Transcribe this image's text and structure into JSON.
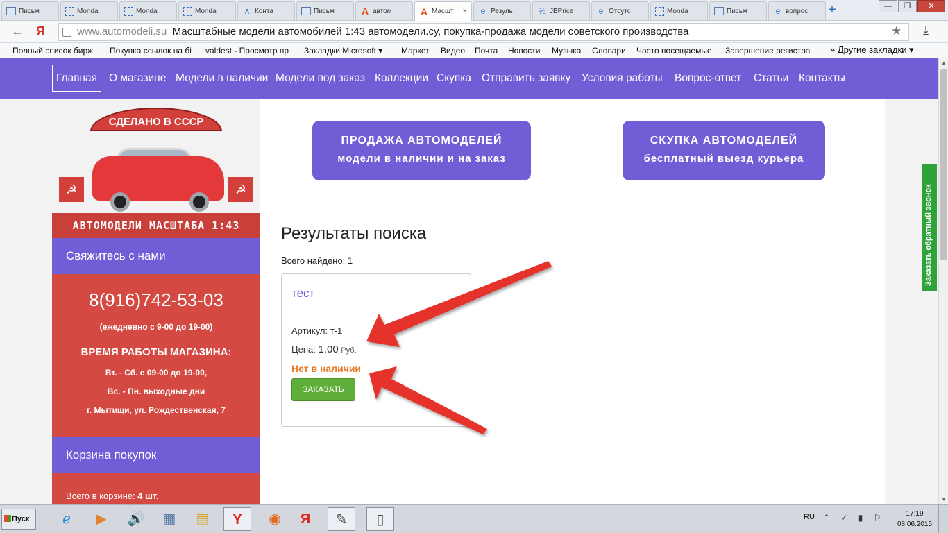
{
  "browser": {
    "tabs": [
      {
        "label": "Письм",
        "icon": "mail-icon"
      },
      {
        "label": "Monda",
        "icon": "monday-icon"
      },
      {
        "label": "Monda",
        "icon": "monday-icon"
      },
      {
        "label": "Monda",
        "icon": "monday-icon"
      },
      {
        "label": "Конта",
        "icon": "contact-icon"
      },
      {
        "label": "Письм",
        "icon": "mail-icon"
      },
      {
        "label": "автом",
        "icon": "automodeli-icon"
      },
      {
        "label": "Масшт",
        "icon": "automodeli-icon",
        "active": true
      },
      {
        "label": "Резуль",
        "icon": "ie-icon"
      },
      {
        "label": "JBPrice",
        "icon": "jbprice-icon"
      },
      {
        "label": "Отсутс",
        "icon": "ie-icon"
      },
      {
        "label": "Monda",
        "icon": "monday-icon"
      },
      {
        "label": "Письм",
        "icon": "mail-icon"
      },
      {
        "label": "вопрос",
        "icon": "ie-icon"
      }
    ],
    "close_tab_glyph": "×",
    "new_tab_glyph": "+",
    "window_buttons": [
      "—",
      "❐",
      "✕"
    ],
    "address": {
      "host": "www.automodeli.su",
      "title": "Масштабные модели автомобилей 1:43 автомодели.су, покупка-продажа модели советского производства"
    },
    "bookmarks": [
      "Полный список бирж",
      "Покупка ссылок на бі",
      "valdest - Просмотр пр",
      "Закладки Microsoft ▾",
      "Маркет",
      "Видео",
      "Почта",
      "Новости",
      "Музыка",
      "Словари",
      "Часто посещаемые",
      "Завершение регистра"
    ],
    "bookmarks_more": "» Другие закладки ▾"
  },
  "site": {
    "nav": [
      {
        "label": "Главная",
        "active": true
      },
      {
        "label": "О магазине"
      },
      {
        "label": "Модели в наличии"
      },
      {
        "label": "Модели под заказ"
      },
      {
        "label": "Коллекции"
      },
      {
        "label": "Скупка"
      },
      {
        "label": "Отправить заявку"
      },
      {
        "label": "Условия работы"
      },
      {
        "label": "Вопрос-ответ"
      },
      {
        "label": "Статьи"
      },
      {
        "label": "Контакты"
      }
    ],
    "logo": {
      "ribbon_text": "СДЕЛАНО В СССР",
      "bottom_text": "АВТОМОДЕЛИ МАСШТАБА 1:43"
    },
    "contact": {
      "heading": "Свяжитесь с нами",
      "phone": "8(916)742-53-03",
      "hours": "(ежедневно с 9-00 до 19-00)",
      "worktime_heading": "ВРЕМЯ РАБОТЫ МАГАЗИНА:",
      "line1": "Вт. - Сб.  с 09-00 до 19-00,",
      "line2": "Вс. - Пн.  выходные дни",
      "address": "г. Мытищи, ул. Рождественская, 7"
    },
    "cart": {
      "heading": "Корзина покупок",
      "label": "Всего в корзине:",
      "count": "4 шт."
    },
    "promo": [
      {
        "title": "ПРОДАЖА АВТОМОДЕЛЕЙ",
        "subtitle": "модели в наличии и на заказ"
      },
      {
        "title": "СКУПКА АВТОМОДЕЛЕЙ",
        "subtitle": "бесплатный выезд курьера"
      }
    ],
    "results": {
      "title": "Результаты поиска",
      "found_label": "Всего найдено:",
      "found_count": "1",
      "items": [
        {
          "name": "тест",
          "sku_label": "Артикул:",
          "sku": "т-1",
          "price_label": "Цена:",
          "price": "1.00",
          "currency": "Руб.",
          "stock": "Нет в наличии",
          "order_label": "ЗАКАЗАТЬ"
        }
      ]
    },
    "callback_label": "Заказать обратный звонок",
    "colors": {
      "brand_purple": "#6f5ed6",
      "sidebar_red": "#d44a42",
      "stock_orange": "#e87722",
      "order_green": "#5fae3a",
      "arrow_red": "#e5332a",
      "callback_green": "#2fa33a"
    }
  },
  "taskbar": {
    "start_label": "Пуск",
    "apps": [
      "ie-icon",
      "media-player-icon",
      "volume-icon",
      "calculator-icon",
      "explorer-icon",
      "yandex-browser-icon",
      "firefox-icon",
      "yandex-icon",
      "notepad-icon",
      "document-icon"
    ],
    "lang": "RU",
    "time": "17:19",
    "date": "08.06.2015"
  }
}
